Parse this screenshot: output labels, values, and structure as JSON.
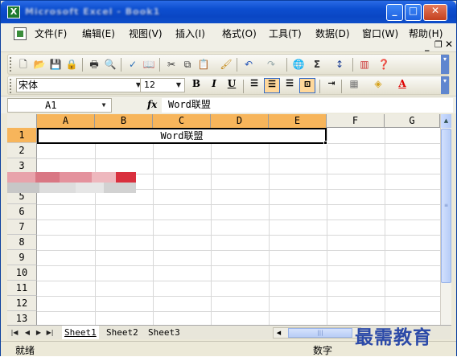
{
  "window": {
    "title": "Microsoft Excel - Book1",
    "controls": {
      "minimize": "_",
      "maximize": "□",
      "close": "✕"
    }
  },
  "menu": {
    "items": [
      "文件(F)",
      "编辑(E)",
      "视图(V)",
      "插入(I)",
      "格式(O)",
      "工具(T)",
      "数据(D)",
      "窗口(W)",
      "帮助(H)"
    ],
    "doc_controls": {
      "minimize": "_",
      "restore": "❐",
      "close": "✕"
    }
  },
  "standard_toolbar": {
    "icons": [
      "new-icon",
      "open-icon",
      "save-icon",
      "permission-icon",
      "print-icon",
      "print-preview-icon",
      "spelling-icon",
      "research-icon",
      "cut-icon",
      "copy-icon",
      "paste-icon",
      "format-painter-icon",
      "undo-icon",
      "redo-icon",
      "hyperlink-icon",
      "autosum-icon",
      "sort-ascending-icon",
      "chart-wizard-icon",
      "help-icon"
    ]
  },
  "format_toolbar": {
    "font": "宋体",
    "size": "12",
    "bold": "B",
    "italic": "I",
    "underline": "U",
    "alignment_selected": "center",
    "merge_active": true
  },
  "formula_bar": {
    "name_box": "A1",
    "fx": "fx",
    "value": "Word联盟"
  },
  "sheet": {
    "columns": [
      "A",
      "B",
      "C",
      "D",
      "E",
      "F",
      "G"
    ],
    "selected_columns": [
      "A",
      "B",
      "C",
      "D",
      "E"
    ],
    "rows": [
      "1",
      "2",
      "3",
      "4",
      "5",
      "6",
      "7",
      "8",
      "9",
      "10",
      "11",
      "12",
      "13"
    ],
    "selected_rows": [
      "1"
    ],
    "merged_range": "A1:E1",
    "merged_text": "Word联盟"
  },
  "sheet_tabs": [
    "Sheet1",
    "Sheet2",
    "Sheet3"
  ],
  "active_sheet": "Sheet1",
  "status": {
    "ready": "就绪",
    "num": "数字"
  },
  "watermark": "最需教育",
  "colors": {
    "title_bar": "#0d4fd0",
    "selected_header": "#f7b55b",
    "grid_line": "#d8d8d8",
    "watermark": "#2c4aa8"
  }
}
